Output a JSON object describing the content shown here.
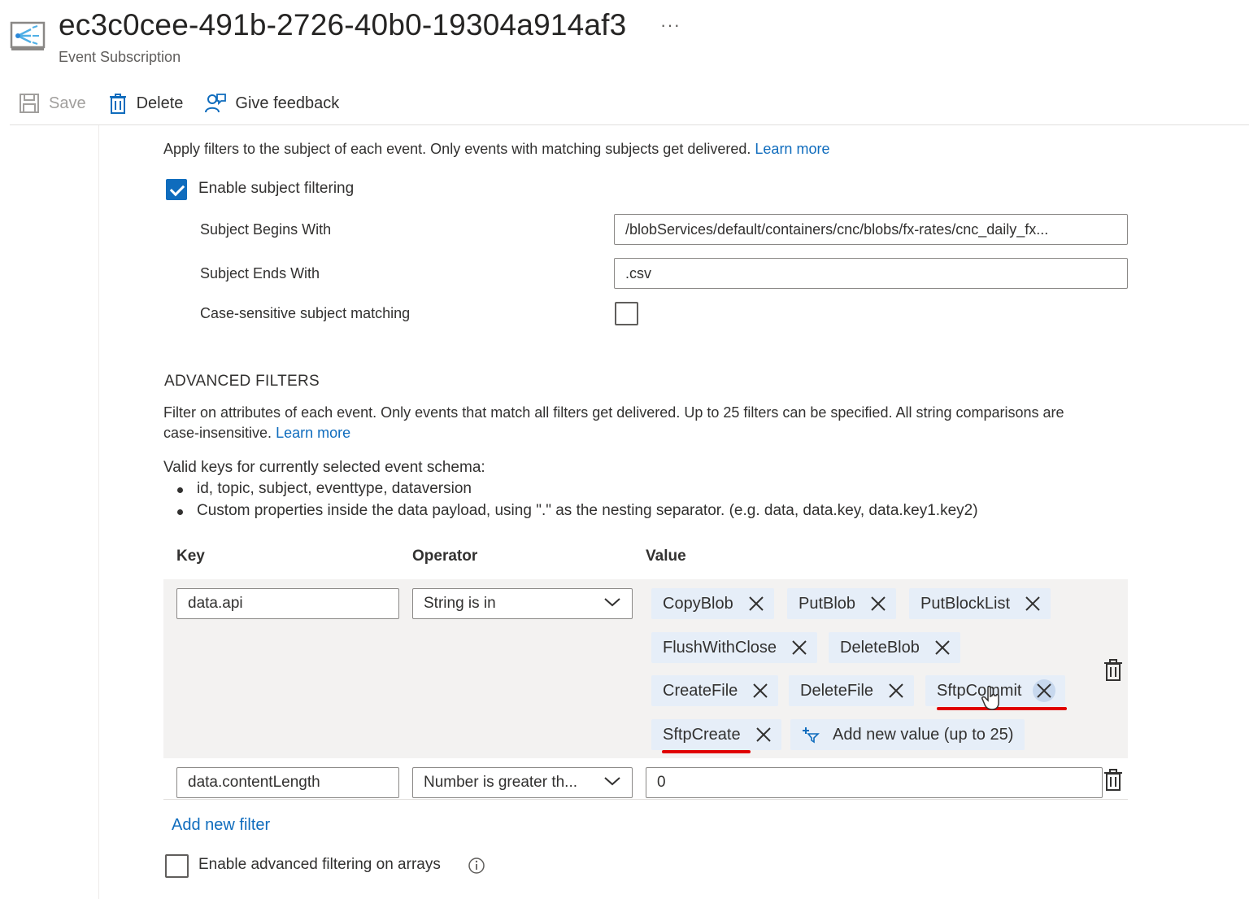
{
  "header": {
    "title": "ec3c0cee-491b-2726-40b0-19304a914af3",
    "subtitle": "Event Subscription",
    "more": "···",
    "icon": "event-grid-icon"
  },
  "toolbar": {
    "save_label": "Save",
    "delete_label": "Delete",
    "feedback_label": "Give feedback"
  },
  "subject_filter": {
    "description": "Apply filters to the subject of each event. Only events with matching subjects get delivered.",
    "learn_more": "Learn more",
    "enable_label": "Enable subject filtering",
    "enabled": true,
    "begins_with_label": "Subject Begins With",
    "begins_with_value": "/blobServices/default/containers/cnc/blobs/fx-rates/cnc_daily_fx...",
    "ends_with_label": "Subject Ends With",
    "ends_with_value": ".csv",
    "case_sensitive_label": "Case-sensitive subject matching",
    "case_sensitive": false
  },
  "advanced_filters": {
    "heading": "ADVANCED FILTERS",
    "description_line1": "Filter on attributes of each event. Only events that match all filters get delivered. Up to 25 filters can be specified. All string comparisons are",
    "description_line2": "case-insensitive.",
    "learn_more": "Learn more",
    "valid_keys_label": "Valid keys for currently selected event schema:",
    "valid_keys": [
      "id, topic, subject, eventtype, dataversion",
      "Custom properties inside the data payload, using \".\" as the nesting separator. (e.g. data, data.key, data.key1.key2)"
    ],
    "columns": {
      "key": "Key",
      "operator": "Operator",
      "value": "Value"
    },
    "filters": [
      {
        "key": "data.api",
        "operator": "String is in",
        "values": [
          "CopyBlob",
          "PutBlob",
          "PutBlockList",
          "FlushWithClose",
          "DeleteBlob",
          "CreateFile",
          "DeleteFile",
          "SftpCommit",
          "SftpCreate"
        ],
        "add_value_label": "Add new value (up to 25)"
      },
      {
        "key": "data.contentLength",
        "operator": "Number is greater th...",
        "value": "0"
      }
    ],
    "add_filter_label": "Add new filter",
    "arrays_label": "Enable advanced filtering on arrays",
    "arrays_enabled": false
  },
  "colors": {
    "accent": "#0f6cbd",
    "chip_bg": "#e6eef8",
    "annotation_red": "#e00000"
  }
}
